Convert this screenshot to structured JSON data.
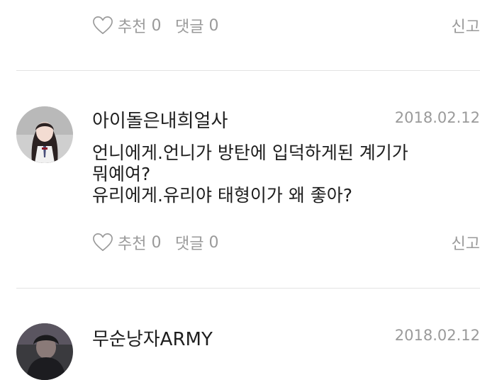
{
  "top_actions": {
    "like_label": "추천",
    "like_count": "0",
    "reply_label": "댓글",
    "reply_count": "0",
    "report_label": "신고"
  },
  "comments": [
    {
      "username": "아이돌은내희얼사",
      "date": "2018.02.12",
      "text_lines": [
        "언니에게.언니가 방탄에 입덕하게된 계기가",
        "뭐예여?",
        "유리에게.유리야 태형이가 왜 좋아?"
      ],
      "like_label": "추천",
      "like_count": "0",
      "reply_label": "댓글",
      "reply_count": "0",
      "report_label": "신고"
    },
    {
      "username": "무순낭자ARMY",
      "date": "2018.02.12"
    }
  ],
  "icons": {
    "like": "heart-outline-icon"
  },
  "colors": {
    "meta_text": "#9a9a9a",
    "primary_text": "#1e1e1e",
    "divider": "#e3e3e3"
  }
}
